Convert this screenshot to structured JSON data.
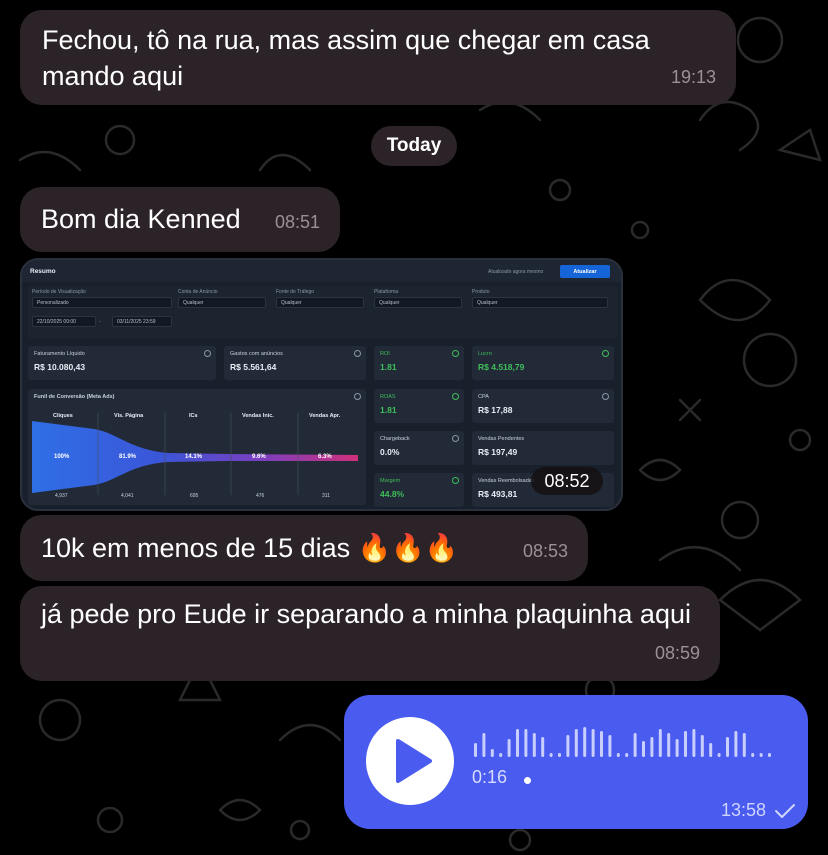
{
  "messages": {
    "m1": {
      "text": "Fechou, tô na rua, mas assim que chegar em casa mando aqui",
      "time": "19:13"
    },
    "date_separator": "Today",
    "m2": {
      "text": "Bom dia Kenned",
      "time": "08:51"
    },
    "m3_image": {
      "time": "08:52"
    },
    "m4": {
      "text": "10k em menos de 15 dias 🔥🔥🔥",
      "time": "08:53"
    },
    "m5": {
      "text": "já pede pro Eude ir separando a minha plaquinha aqui",
      "time": "08:59"
    },
    "voice": {
      "duration": "0:16",
      "time": "13:58",
      "status": "read-check"
    }
  },
  "screenshot": {
    "title": "Resumo",
    "updated": "Atualizado agora mesmo",
    "refresh_label": "Atualizar",
    "filters": {
      "periodo_label": "Período de Visualização",
      "periodo_value": "Personalizado",
      "date_start": "22/10/2025 00:00",
      "date_sep": "-",
      "date_end": "03/11/2025 23:59",
      "conta_label": "Conta de Anúncio",
      "conta_value": "Qualquer",
      "fonte_label": "Fonte de Tráfego",
      "fonte_value": "Qualquer",
      "plataforma_label": "Plataforma",
      "plataforma_value": "Qualquer",
      "produto_label": "Produto",
      "produto_value": "Qualquer"
    },
    "cards": {
      "faturamento_label": "Faturamento Líquido",
      "faturamento_value": "R$ 10.080,43",
      "gastos_label": "Gastos com anúncios",
      "gastos_value": "R$ 5.561,64",
      "roi_label": "ROI",
      "roi_value": "1.81",
      "lucro_label": "Lucro",
      "lucro_value": "R$ 4.518,79",
      "roas_label": "ROAS",
      "roas_value": "1.81",
      "cpa_label": "CPA",
      "cpa_value": "R$ 17,88",
      "chargeback_label": "Chargeback",
      "chargeback_value": "0.0%",
      "pendentes_label": "Vendas Pendentes",
      "pendentes_value": "R$ 197,49",
      "margem_label": "Margem",
      "margem_value": "44.8%",
      "reemb_label": "Vendas Reembolsadas",
      "reemb_value": "R$ 493,81"
    },
    "funnel": {
      "title": "Funil de Conversão (Meta Ads)",
      "stages": [
        {
          "name": "Cliques",
          "percent": "100%",
          "count": "4,937"
        },
        {
          "name": "Vis. Página",
          "percent": "81.9%",
          "count": "4,041"
        },
        {
          "name": "ICs",
          "percent": "14.1%",
          "count": "695"
        },
        {
          "name": "Vendas Inic.",
          "percent": "9.6%",
          "count": "476"
        },
        {
          "name": "Vendas Apr.",
          "percent": "6.3%",
          "count": "311"
        }
      ]
    }
  },
  "colors": {
    "incoming_bubble": "#2b2328",
    "outgoing_bubble": "#4a5bf0",
    "background": "#000000"
  }
}
